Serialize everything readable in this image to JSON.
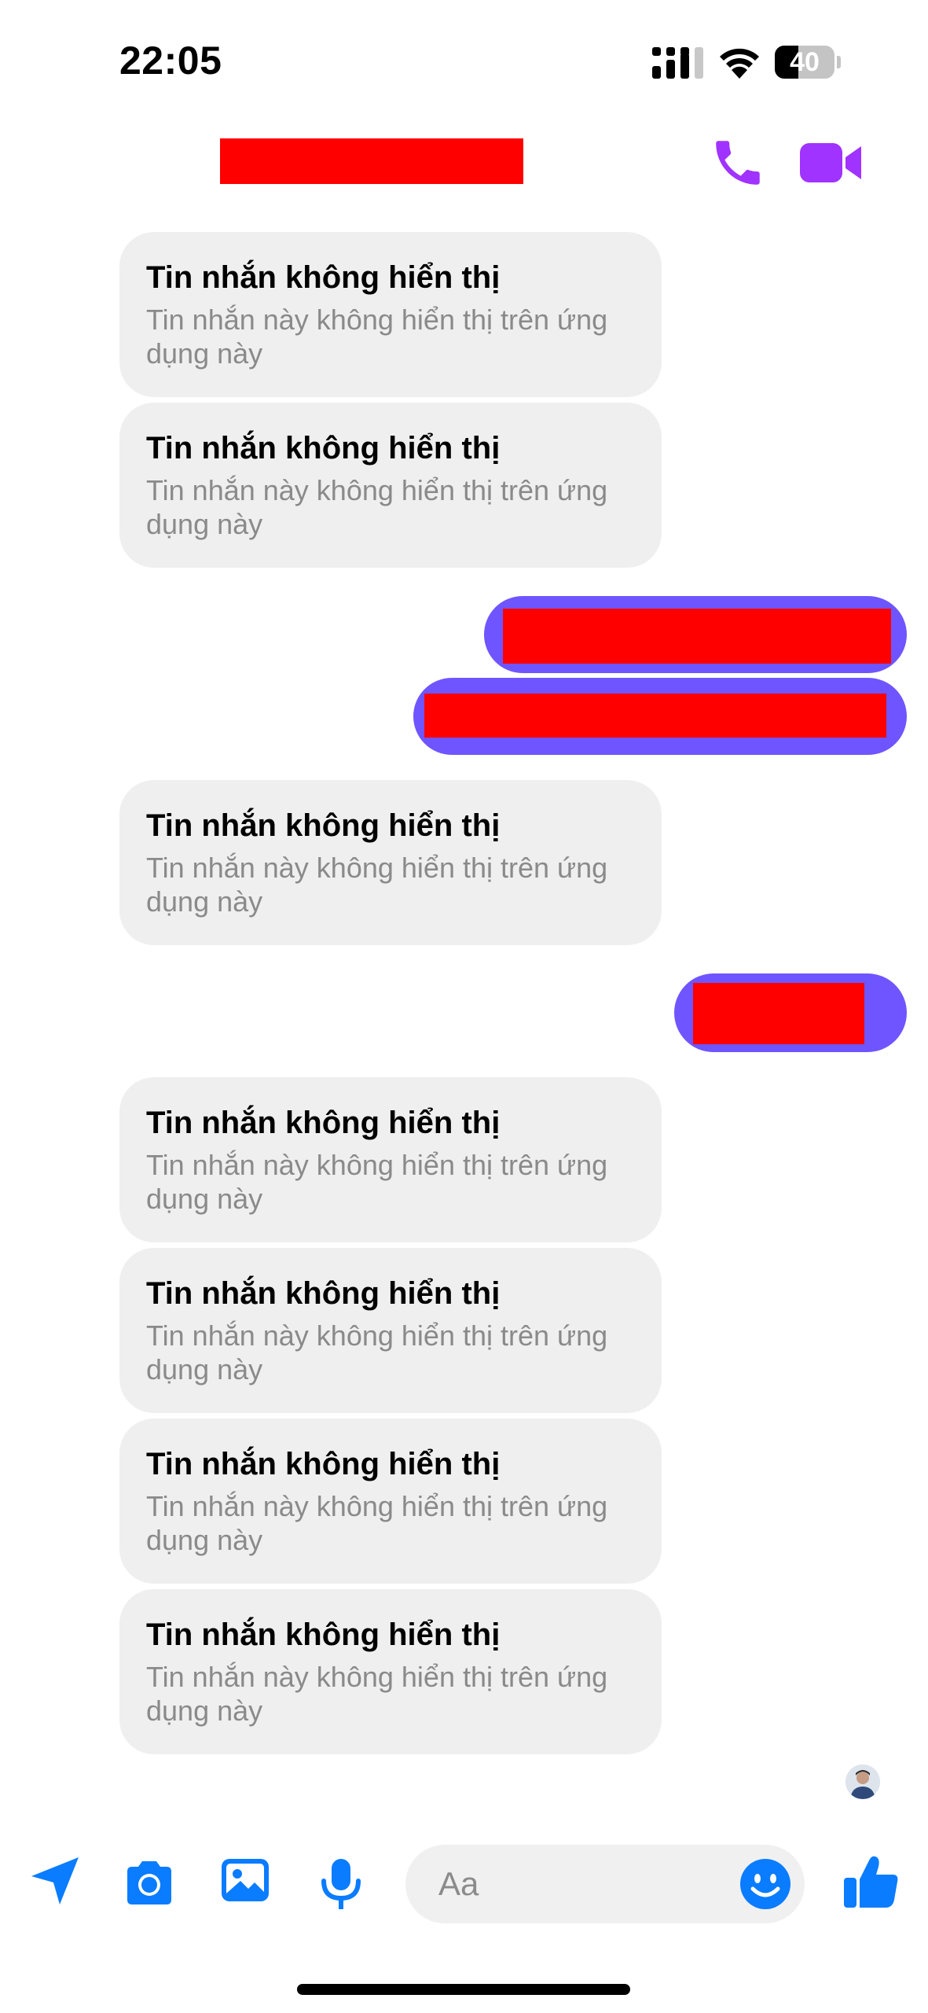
{
  "status_bar": {
    "time": "22:05",
    "battery_percent": "40",
    "battery_level": 0.4
  },
  "header": {
    "contact_name_redacted": true,
    "call_icon": "phone-icon",
    "video_icon": "video-camera-icon"
  },
  "messages": [
    {
      "direction": "incoming",
      "title": "Tin nhắn không hiển thị",
      "body": "Tin nhắn này không hiển thị trên ứng dụng này"
    },
    {
      "direction": "incoming",
      "title": "Tin nhắn không hiển thị",
      "body": "Tin nhắn này không hiển thị trên ứng dụng này"
    },
    {
      "direction": "outgoing",
      "redacted": true
    },
    {
      "direction": "outgoing",
      "redacted": true
    },
    {
      "direction": "incoming",
      "title": "Tin nhắn không hiển thị",
      "body": "Tin nhắn này không hiển thị trên ứng dụng này"
    },
    {
      "direction": "outgoing",
      "redacted": true
    },
    {
      "direction": "incoming",
      "title": "Tin nhắn không hiển thị",
      "body": "Tin nhắn này không hiển thị trên ứng dụng này"
    },
    {
      "direction": "incoming",
      "title": "Tin nhắn không hiển thị",
      "body": "Tin nhắn này không hiển thị trên ứng dụng này"
    },
    {
      "direction": "incoming",
      "title": "Tin nhắn không hiển thị",
      "body": "Tin nhắn này không hiển thị trên ứng dụng này"
    },
    {
      "direction": "incoming",
      "title": "Tin nhắn không hiển thị",
      "body": "Tin nhắn này không hiển thị trên ứng dụng này"
    }
  ],
  "composer": {
    "placeholder": "Aa",
    "icons": [
      "send-location-icon",
      "camera-icon",
      "gallery-icon",
      "microphone-icon",
      "emoji-icon",
      "thumbs-up-icon"
    ]
  },
  "colors": {
    "accent": "#a033ff",
    "outgoing_bubble": "#6f55ff",
    "incoming_bubble": "#efefef",
    "composer_icon": "#0a7cff",
    "redaction": "#ff0000"
  }
}
